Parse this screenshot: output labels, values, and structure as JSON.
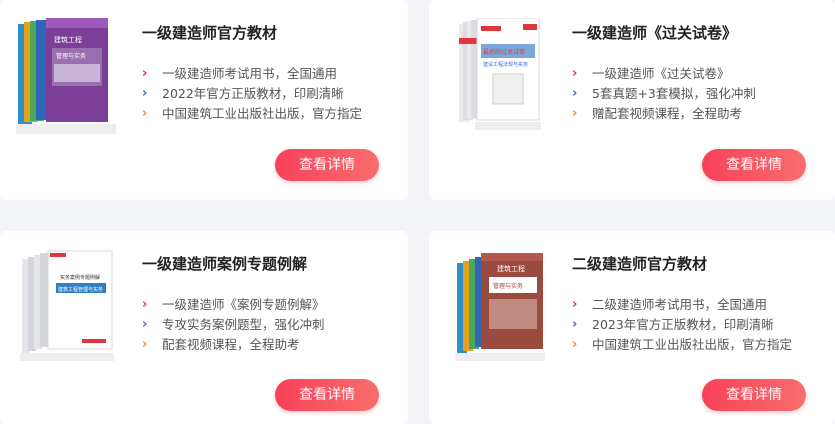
{
  "button_label": "查看详情",
  "cards": [
    {
      "title": "一级建造师官方教材",
      "features": [
        "一级建造师考试用书，全国通用",
        "2022年官方正版教材，印刷清晰",
        "中国建筑工业出版社出版，官方指定"
      ],
      "book_text": [
        "建筑工程",
        "管理与实务"
      ]
    },
    {
      "title": "一级建造师《过关试卷》",
      "features": [
        "一级建造师《过关试卷》",
        "5套真题+3套模拟，强化冲刺",
        "赠配套视频课程，全程助考"
      ],
      "book_text": [
        "最后的过关试卷",
        "建设工程法规与实务"
      ]
    },
    {
      "title": "一级建造师案例专题例解",
      "features": [
        "一级建造师《案例专题例解》",
        "专攻实务案例题型，强化冲刺",
        "配套视频课程，全程助考"
      ],
      "book_text": [
        "实务案例专题例解",
        "建筑工程管理与实务"
      ]
    },
    {
      "title": "二级建造师官方教材",
      "features": [
        "二级建造师考试用书，全国通用",
        "2023年官方正版教材，印刷清晰",
        "中国建筑工业出版社出版，官方指定"
      ],
      "book_text": [
        "建筑工程",
        "管理与实务"
      ]
    }
  ],
  "arrow_colors": [
    "#e6303c",
    "#3a66d8",
    "#f08a2b"
  ]
}
